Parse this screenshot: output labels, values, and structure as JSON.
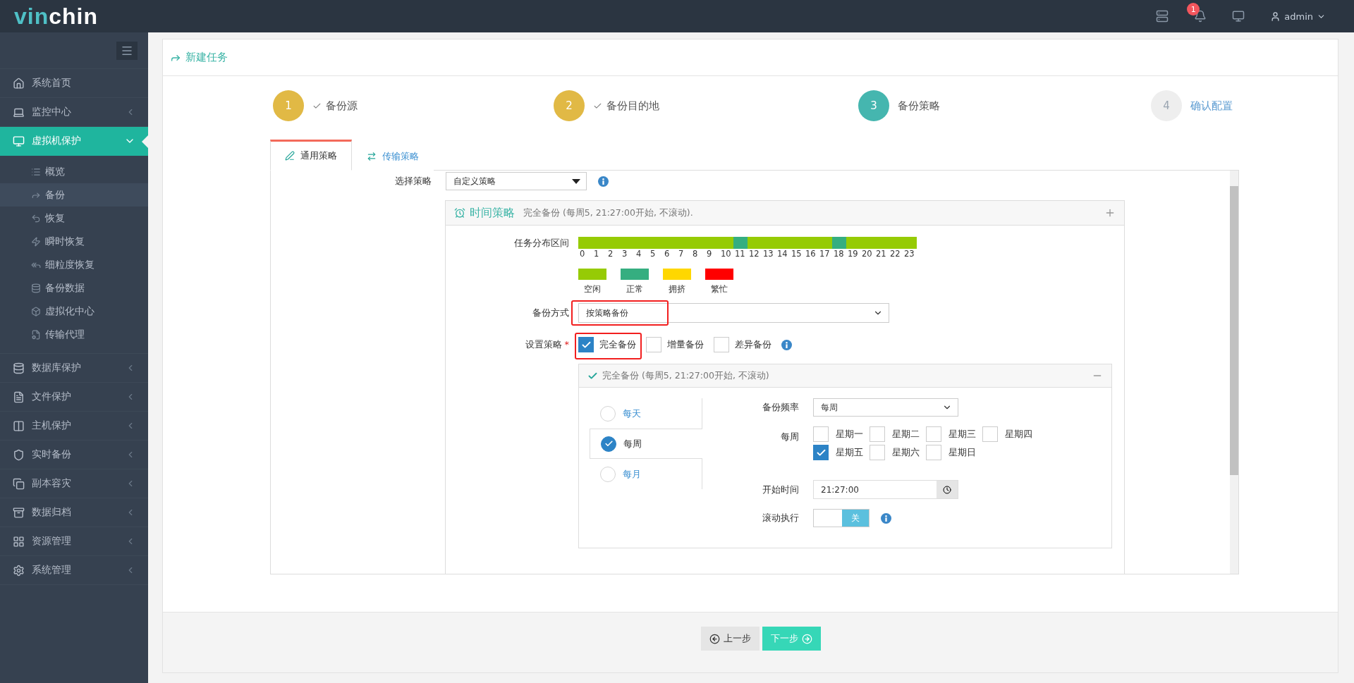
{
  "brand": {
    "part1": "vin",
    "part2": "chin"
  },
  "header": {
    "notification_count": "1",
    "user": "admin"
  },
  "sidebar": {
    "items": [
      {
        "label": "系统首页",
        "kind": "link",
        "selected": false
      },
      {
        "label": "监控中心",
        "kind": "group",
        "expanded": false,
        "selected": false
      },
      {
        "label": "虚拟机保护",
        "kind": "group",
        "expanded": true,
        "selected": true,
        "children": [
          {
            "label": "概览",
            "selected": false
          },
          {
            "label": "备份",
            "selected": true
          },
          {
            "label": "恢复",
            "selected": false
          },
          {
            "label": "瞬时恢复",
            "selected": false
          },
          {
            "label": "细粒度恢复",
            "selected": false
          },
          {
            "label": "备份数据",
            "selected": false
          },
          {
            "label": "虚拟化中心",
            "selected": false
          },
          {
            "label": "传输代理",
            "selected": false
          }
        ]
      },
      {
        "label": "数据库保护",
        "kind": "group",
        "expanded": false,
        "selected": false
      },
      {
        "label": "文件保护",
        "kind": "group",
        "expanded": false,
        "selected": false
      },
      {
        "label": "主机保护",
        "kind": "group",
        "expanded": false,
        "selected": false
      },
      {
        "label": "实时备份",
        "kind": "group",
        "expanded": false,
        "selected": false
      },
      {
        "label": "副本容灾",
        "kind": "group",
        "expanded": false,
        "selected": false
      },
      {
        "label": "数据归档",
        "kind": "group",
        "expanded": false,
        "selected": false
      },
      {
        "label": "资源管理",
        "kind": "group",
        "expanded": false,
        "selected": false
      },
      {
        "label": "系统管理",
        "kind": "group",
        "expanded": false,
        "selected": false
      }
    ]
  },
  "page_title": "新建任务",
  "steps": [
    {
      "number": "1",
      "label": "备份源",
      "completed": true,
      "selected": false
    },
    {
      "number": "2",
      "label": "备份目的地",
      "completed": true,
      "selected": false
    },
    {
      "number": "3",
      "label": "备份策略",
      "completed": false,
      "selected": true
    },
    {
      "number": "4",
      "label": "确认配置",
      "completed": false,
      "selected": false
    }
  ],
  "tabs": [
    {
      "label": "通用策略",
      "selected": true
    },
    {
      "label": "传输策略",
      "selected": false
    }
  ],
  "strategy_select": {
    "label": "选择策略",
    "value": "自定义策略"
  },
  "time_policy": {
    "title": "时间策略",
    "summary": "完全备份 (每周5, 21:27:00开始, 不滚动).",
    "distribution_label": "任务分布区间",
    "hours": [
      {
        "label": "0",
        "color": "#96cb05"
      },
      {
        "label": "1",
        "color": "#96cb05"
      },
      {
        "label": "2",
        "color": "#96cb05"
      },
      {
        "label": "3",
        "color": "#96cb05"
      },
      {
        "label": "4",
        "color": "#96cb05"
      },
      {
        "label": "5",
        "color": "#96cb05"
      },
      {
        "label": "6",
        "color": "#96cb05"
      },
      {
        "label": "7",
        "color": "#96cb05"
      },
      {
        "label": "8",
        "color": "#96cb05"
      },
      {
        "label": "9",
        "color": "#96cb05"
      },
      {
        "label": "10",
        "color": "#96cb05"
      },
      {
        "label": "11",
        "color": "#35ae80"
      },
      {
        "label": "12",
        "color": "#96cb05"
      },
      {
        "label": "13",
        "color": "#96cb05"
      },
      {
        "label": "14",
        "color": "#96cb05"
      },
      {
        "label": "15",
        "color": "#96cb05"
      },
      {
        "label": "16",
        "color": "#96cb05"
      },
      {
        "label": "17",
        "color": "#96cb05"
      },
      {
        "label": "18",
        "color": "#35ae80"
      },
      {
        "label": "19",
        "color": "#96cb05"
      },
      {
        "label": "20",
        "color": "#96cb05"
      },
      {
        "label": "21",
        "color": "#96cb05"
      },
      {
        "label": "22",
        "color": "#96cb05"
      },
      {
        "label": "23",
        "color": "#96cb05"
      }
    ],
    "legend": [
      {
        "label": "空闲",
        "color": "#96cb05"
      },
      {
        "label": "正常",
        "color": "#35ae80"
      },
      {
        "label": "拥挤",
        "color": "#ffd700"
      },
      {
        "label": "繁忙",
        "color": "#ff0000"
      }
    ],
    "method": {
      "label": "备份方式",
      "value": "按策略备份",
      "highlighted": true
    },
    "policy": {
      "label": "设置策略",
      "required_mark": "*",
      "options": [
        {
          "label": "完全备份",
          "checked": true,
          "highlighted": true
        },
        {
          "label": "增量备份",
          "checked": false,
          "highlighted": false
        },
        {
          "label": "差异备份",
          "checked": false,
          "highlighted": false
        }
      ]
    },
    "schedule": {
      "title": "完全备份 (每周5, 21:27:00开始, 不滚动)",
      "frequencies": [
        {
          "label": "每天",
          "selected": false
        },
        {
          "label": "每周",
          "selected": true
        },
        {
          "label": "每月",
          "selected": false
        }
      ],
      "frequency": {
        "label": "备份频率",
        "value": "每周"
      },
      "weekdays": {
        "label": "每周",
        "days": [
          {
            "label": "星期一",
            "checked": false
          },
          {
            "label": "星期二",
            "checked": false
          },
          {
            "label": "星期三",
            "checked": false
          },
          {
            "label": "星期四",
            "checked": false
          },
          {
            "label": "星期五",
            "checked": true
          },
          {
            "label": "星期六",
            "checked": false
          },
          {
            "label": "星期日",
            "checked": false
          }
        ]
      },
      "start_time": {
        "label": "开始时间",
        "value": "21:27:00"
      },
      "rolling": {
        "label": "滚动执行",
        "on": false,
        "state_text": "关"
      }
    }
  },
  "buttons": {
    "prev": "上一步",
    "next": "下一步"
  }
}
